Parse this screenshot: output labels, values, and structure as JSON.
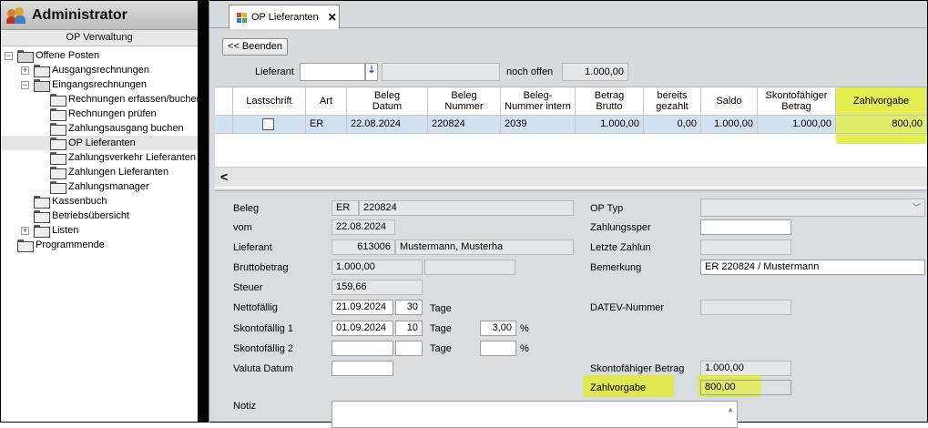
{
  "app": {
    "title": "Administrator",
    "subtitle": "OP Verwaltung"
  },
  "colors": {
    "highlight": "#dfeb35",
    "row_selected": "#d2e1f2"
  },
  "tree": [
    {
      "label": "Offene Posten",
      "level": 0,
      "expand": "minus",
      "open": true
    },
    {
      "label": "Ausgangsrechnungen",
      "level": 1,
      "expand": "plus"
    },
    {
      "label": "Eingangsrechnungen",
      "level": 1,
      "expand": "minus",
      "open": true
    },
    {
      "label": "Rechnungen erfassen/buchen",
      "level": 2
    },
    {
      "label": "Rechnungen prüfen",
      "level": 2
    },
    {
      "label": "Zahlungsausgang buchen",
      "level": 2
    },
    {
      "label": "OP Lieferanten",
      "level": 2,
      "selected": true
    },
    {
      "label": "Zahlungsverkehr Lieferanten",
      "level": 2
    },
    {
      "label": "Zahlungen Lieferanten",
      "level": 2
    },
    {
      "label": "Zahlungsmanager",
      "level": 2
    },
    {
      "label": "Kassenbuch",
      "level": 1
    },
    {
      "label": "Betriebsübersicht",
      "level": 1
    },
    {
      "label": "Listen",
      "level": 1,
      "expand": "plus"
    },
    {
      "label": "Programmende",
      "level": 0
    }
  ],
  "tab": {
    "label": "OP Lieferanten",
    "close": "✕"
  },
  "toolbar": {
    "back_label": "<< Beenden"
  },
  "filter": {
    "lieferant_label": "Lieferant",
    "lieferant_value": "",
    "lieferant_name": "",
    "noch_offen_label": "noch offen",
    "noch_offen_value": "1.000,00"
  },
  "grid": {
    "columns": [
      "Lastschrift",
      "Art",
      "Beleg\nDatum",
      "Beleg\nNummer",
      "Beleg-\nNummer intern",
      "Betrag\nBrutto",
      "bereits\ngezahlt",
      "Saldo",
      "Skontofähiger\nBetrag",
      "Zahlvorgabe"
    ],
    "row": {
      "lastschrift": false,
      "art": "ER",
      "datum": "22.08.2024",
      "nummer": "220824",
      "intern": "2039",
      "brutto": "1.000,00",
      "gezahlt": "0,00",
      "saldo": "1.000,00",
      "skonto_betrag": "1.000,00",
      "zahlvorgabe": "800,00"
    },
    "scroll_left": "<"
  },
  "detail": {
    "beleg_label": "Beleg",
    "beleg_art": "ER",
    "beleg_nr": "220824",
    "vom_label": "vom",
    "vom_value": "22.08.2024",
    "lieferant_label": "Lieferant",
    "lieferant_nr": "613006",
    "lieferant_name": "Mustermann, Musterha",
    "brutto_label": "Bruttobetrag",
    "brutto_value": "1.000,00",
    "steuer_label": "Steuer",
    "steuer_value": "159,66",
    "netto_label": "Nettofällig",
    "netto_date": "21.09.2024",
    "netto_days": "30",
    "tage1": "Tage",
    "skonto1_label": "Skontofällig 1",
    "skonto1_date": "01.09.2024",
    "skonto1_days": "10",
    "tage2": "Tage",
    "skonto1_pct": "3,00",
    "pct1": "%",
    "skonto2_label": "Skontofällig 2",
    "tage3": "Tage",
    "pct2": "%",
    "valuta_label": "Valuta Datum",
    "notiz_label": "Notiz",
    "optyp_label": "OP Typ",
    "sperre_label": "Zahlungssper",
    "letzte_label": "Letzte Zahlun",
    "bemerkung_label": "Bemerkung",
    "bemerkung_value": "ER 220824 / Mustermann",
    "datev_label": "DATEV-Nummer",
    "skonto_betrag_label": "Skontofähiger Betrag",
    "skonto_betrag_value": "1.000,00",
    "zahlvorgabe_label": "Zahlvorgabe",
    "zahlvorgabe_value": "800,00"
  }
}
